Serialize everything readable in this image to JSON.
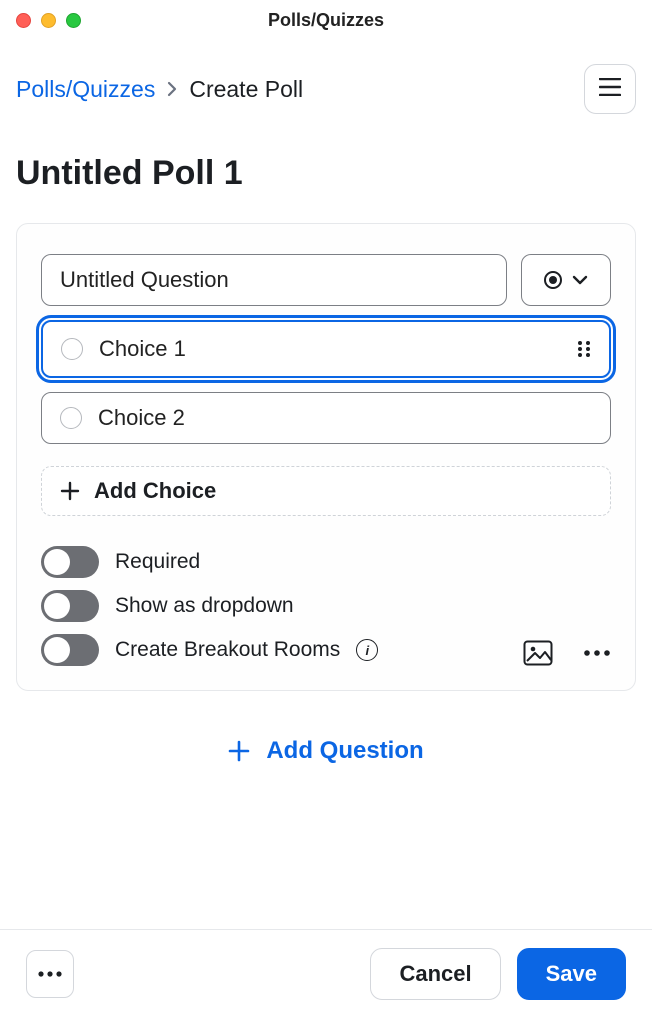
{
  "window": {
    "title": "Polls/Quizzes"
  },
  "breadcrumb": {
    "root": "Polls/Quizzes",
    "current": "Create Poll"
  },
  "page": {
    "title": "Untitled Poll 1"
  },
  "question": {
    "text": "Untitled Question",
    "choices": [
      {
        "label": "Choice 1",
        "selected": true
      },
      {
        "label": "Choice 2",
        "selected": false
      }
    ],
    "add_choice_label": "Add Choice",
    "toggles": {
      "required": {
        "label": "Required",
        "value": false
      },
      "dropdown": {
        "label": "Show as dropdown",
        "value": false
      },
      "breakout": {
        "label": "Create Breakout Rooms",
        "value": false
      }
    }
  },
  "add_question_label": "Add Question",
  "footer": {
    "cancel_label": "Cancel",
    "save_label": "Save"
  },
  "colors": {
    "accent": "#0b66e4"
  }
}
